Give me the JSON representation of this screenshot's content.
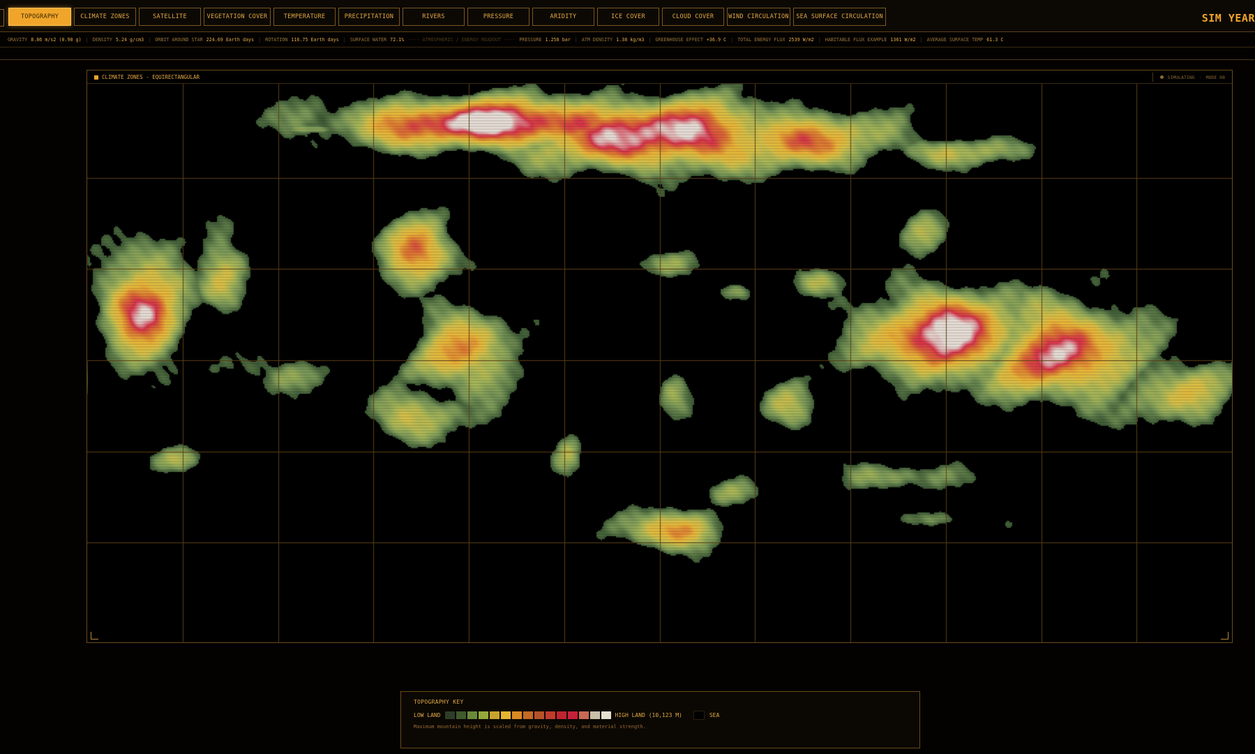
{
  "tabs": [
    {
      "label": "TOPOGRAPHY",
      "active": true
    },
    {
      "label": "CLIMATE ZONES"
    },
    {
      "label": "SATELLITE"
    },
    {
      "label": "VEGETATION COVER"
    },
    {
      "label": "TEMPERATURE"
    },
    {
      "label": "PRECIPITATION"
    },
    {
      "label": "RIVERS"
    },
    {
      "label": "PRESSURE"
    },
    {
      "label": "ARIDITY"
    },
    {
      "label": "ICE COVER"
    },
    {
      "label": "CLOUD COVER"
    },
    {
      "label": "WIND CIRCULATION"
    },
    {
      "label": "SEA SURFACE CIRCULATION"
    }
  ],
  "sim_year_label": "SIM YEAR",
  "readout": {
    "gravity": {
      "label": "GRAVITY",
      "value": "8.86 m/s2 (0.90 g)"
    },
    "density": {
      "label": "DENSITY",
      "value": "5.24 g/cm3"
    },
    "orbit": {
      "label": "ORBIT AROUND STAR",
      "value": "224.69 Earth days"
    },
    "rotation": {
      "label": "ROTATION",
      "value": "116.75 Earth days"
    },
    "surface_water": {
      "label": "SURFACE WATER",
      "value": "72.1%"
    },
    "section_label": "---- ATMOSPHERIC / ENERGY READOUT ----",
    "pressure": {
      "label": "PRESSURE",
      "value": "1.258 bar"
    },
    "atm_density": {
      "label": "ATM DENSITY",
      "value": "1.38 kg/m3"
    },
    "greenhouse": {
      "label": "GREENHOUSE EFFECT",
      "value": "+36.9 C"
    },
    "energy_flux": {
      "label": "TOTAL ENERGY FLUX",
      "value": "2539 W/m2"
    },
    "habitable_flux": {
      "label": "HABITABLE FLUX EXAMPLE",
      "value": "1361 W/m2"
    },
    "avg_temp": {
      "label": "AVERAGE SURFACE TEMP",
      "value": "61.3 C"
    }
  },
  "map_panel": {
    "title": "CLIMATE ZONES - EQUIRECTANGULAR",
    "status": "SIMULATING",
    "mode": "MODE 08"
  },
  "legend": {
    "title": "TOPOGRAPHY KEY",
    "low_label": "LOW LAND",
    "high_label": "HIGH LAND (10,123 M)",
    "sea_label": "SEA",
    "note": "Maximum mountain height is scaled from gravity, density, and material strength.",
    "colors": [
      "#2e3d27",
      "#3f5a2c",
      "#6a8a3a",
      "#95a83b",
      "#c9a42c",
      "#e7b430",
      "#d98a25",
      "#c46a25",
      "#b6522a",
      "#c33b2a",
      "#bf2530",
      "#c8203a",
      "#c96a55",
      "#c8c0a8",
      "#e6e0d0"
    ]
  },
  "map_style": {
    "ocean": "#000000",
    "grid": "#5c3f15",
    "elevation_ramp": [
      "#3d5a36",
      "#7c9a5a",
      "#a8b85a",
      "#d8c24a",
      "#ecb83a",
      "#e07a34",
      "#d9334a",
      "#e8e0d8"
    ]
  },
  "icons": {
    "title_marker": "square-marker-icon",
    "status_marker": "status-dot-icon"
  }
}
